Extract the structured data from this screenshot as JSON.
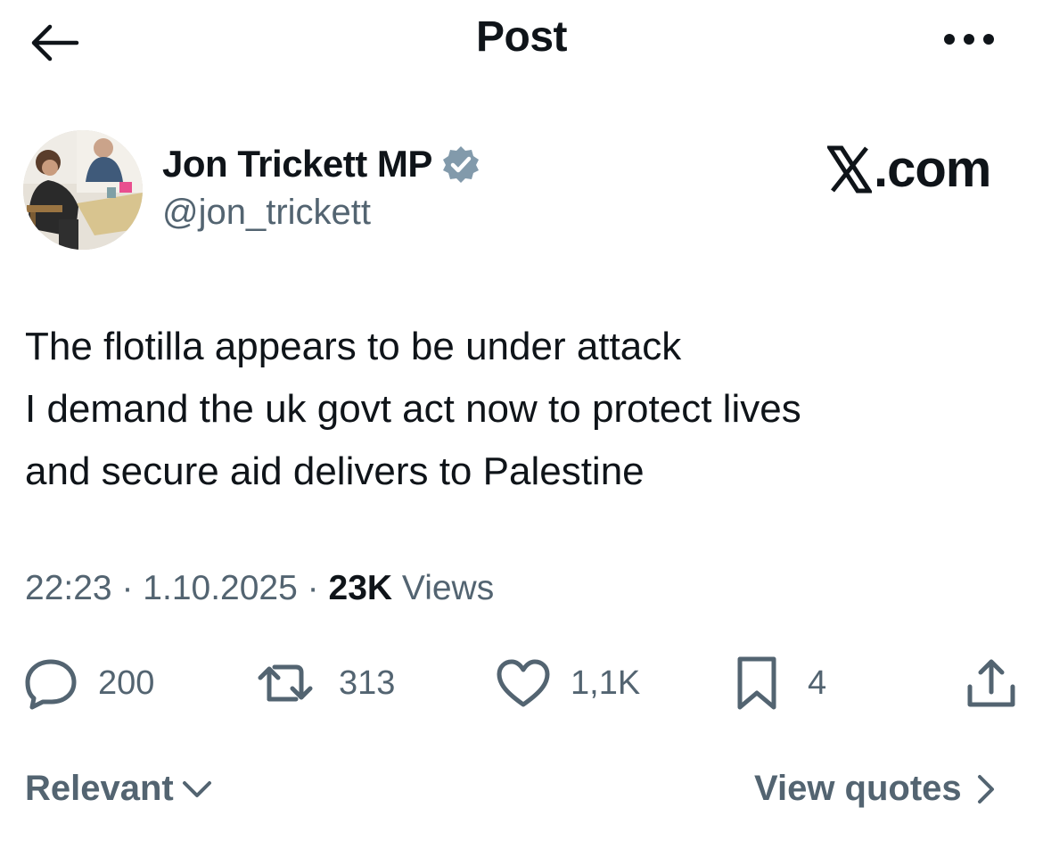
{
  "header": {
    "title": "Post",
    "back_icon": "arrow-left-icon",
    "more_icon": "more-horizontal-icon"
  },
  "author": {
    "name": "Jon Trickett MP",
    "handle": "@jon_trickett",
    "verified": true,
    "verified_color": "#829aab"
  },
  "watermark": {
    "label": ".com",
    "logo_letter": "X"
  },
  "tweet": {
    "lines": [
      "The flotilla appears to be under attack",
      "I demand the uk govt act now to protect lives",
      "and secure aid delivers to Palestine"
    ]
  },
  "meta": {
    "time": "22:23",
    "separator": "·",
    "date": "1.10.2025",
    "views_count": "23K",
    "views_label": "Views"
  },
  "actions": {
    "replies": "200",
    "reposts": "313",
    "likes": "1,1K",
    "bookmarks": "4"
  },
  "footer": {
    "sort_label": "Relevant",
    "view_quotes_label": "View quotes"
  },
  "colors": {
    "text": "#0f1419",
    "secondary": "#536471",
    "background": "#ffffff"
  }
}
